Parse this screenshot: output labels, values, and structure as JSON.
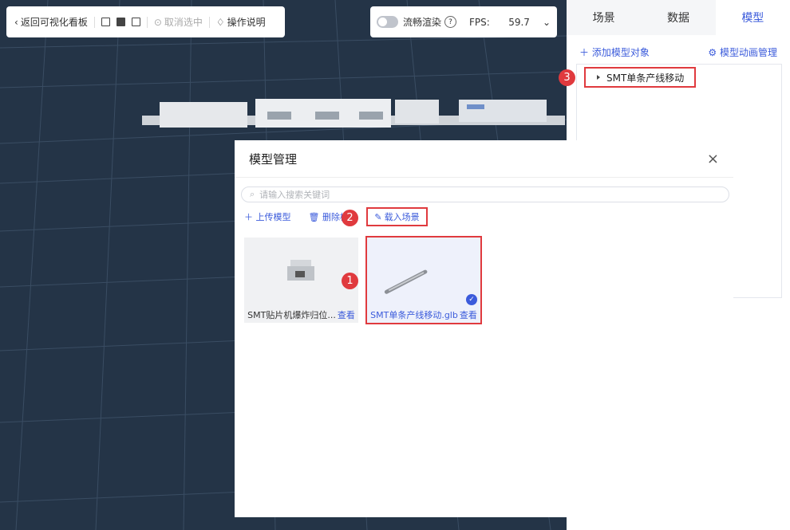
{
  "toolbar": {
    "back_label": "返回可视化看板",
    "deselect_label": "取消选中",
    "help_label": "操作说明"
  },
  "render": {
    "smooth_label": "流畅渲染",
    "fps_label": "FPS:",
    "fps_value": "59.7"
  },
  "right_panel": {
    "tabs": [
      {
        "label": "场景",
        "active": false
      },
      {
        "label": "数据",
        "active": false
      },
      {
        "label": "模型",
        "active": true
      }
    ],
    "add_label": "添加模型对象",
    "anim_label": "模型动画管理",
    "tree_item": "SMT单条产线移动"
  },
  "dialog": {
    "title": "模型管理",
    "close": "×",
    "search_placeholder": "请输入搜索关键词",
    "upload_label": "上传模型",
    "delete_label": "删除模",
    "load_label": "载入场景",
    "cards": [
      {
        "name": "SMT贴片机爆炸归位...",
        "view": "查看",
        "selected": false
      },
      {
        "name": "SMT单条产线移动.glb",
        "view": "查看",
        "selected": true
      }
    ]
  },
  "badges": [
    "1",
    "2",
    "3"
  ],
  "colors": {
    "accent": "#3b5bdb",
    "highlight": "#e03a3e",
    "scene_bg": "#243447"
  }
}
